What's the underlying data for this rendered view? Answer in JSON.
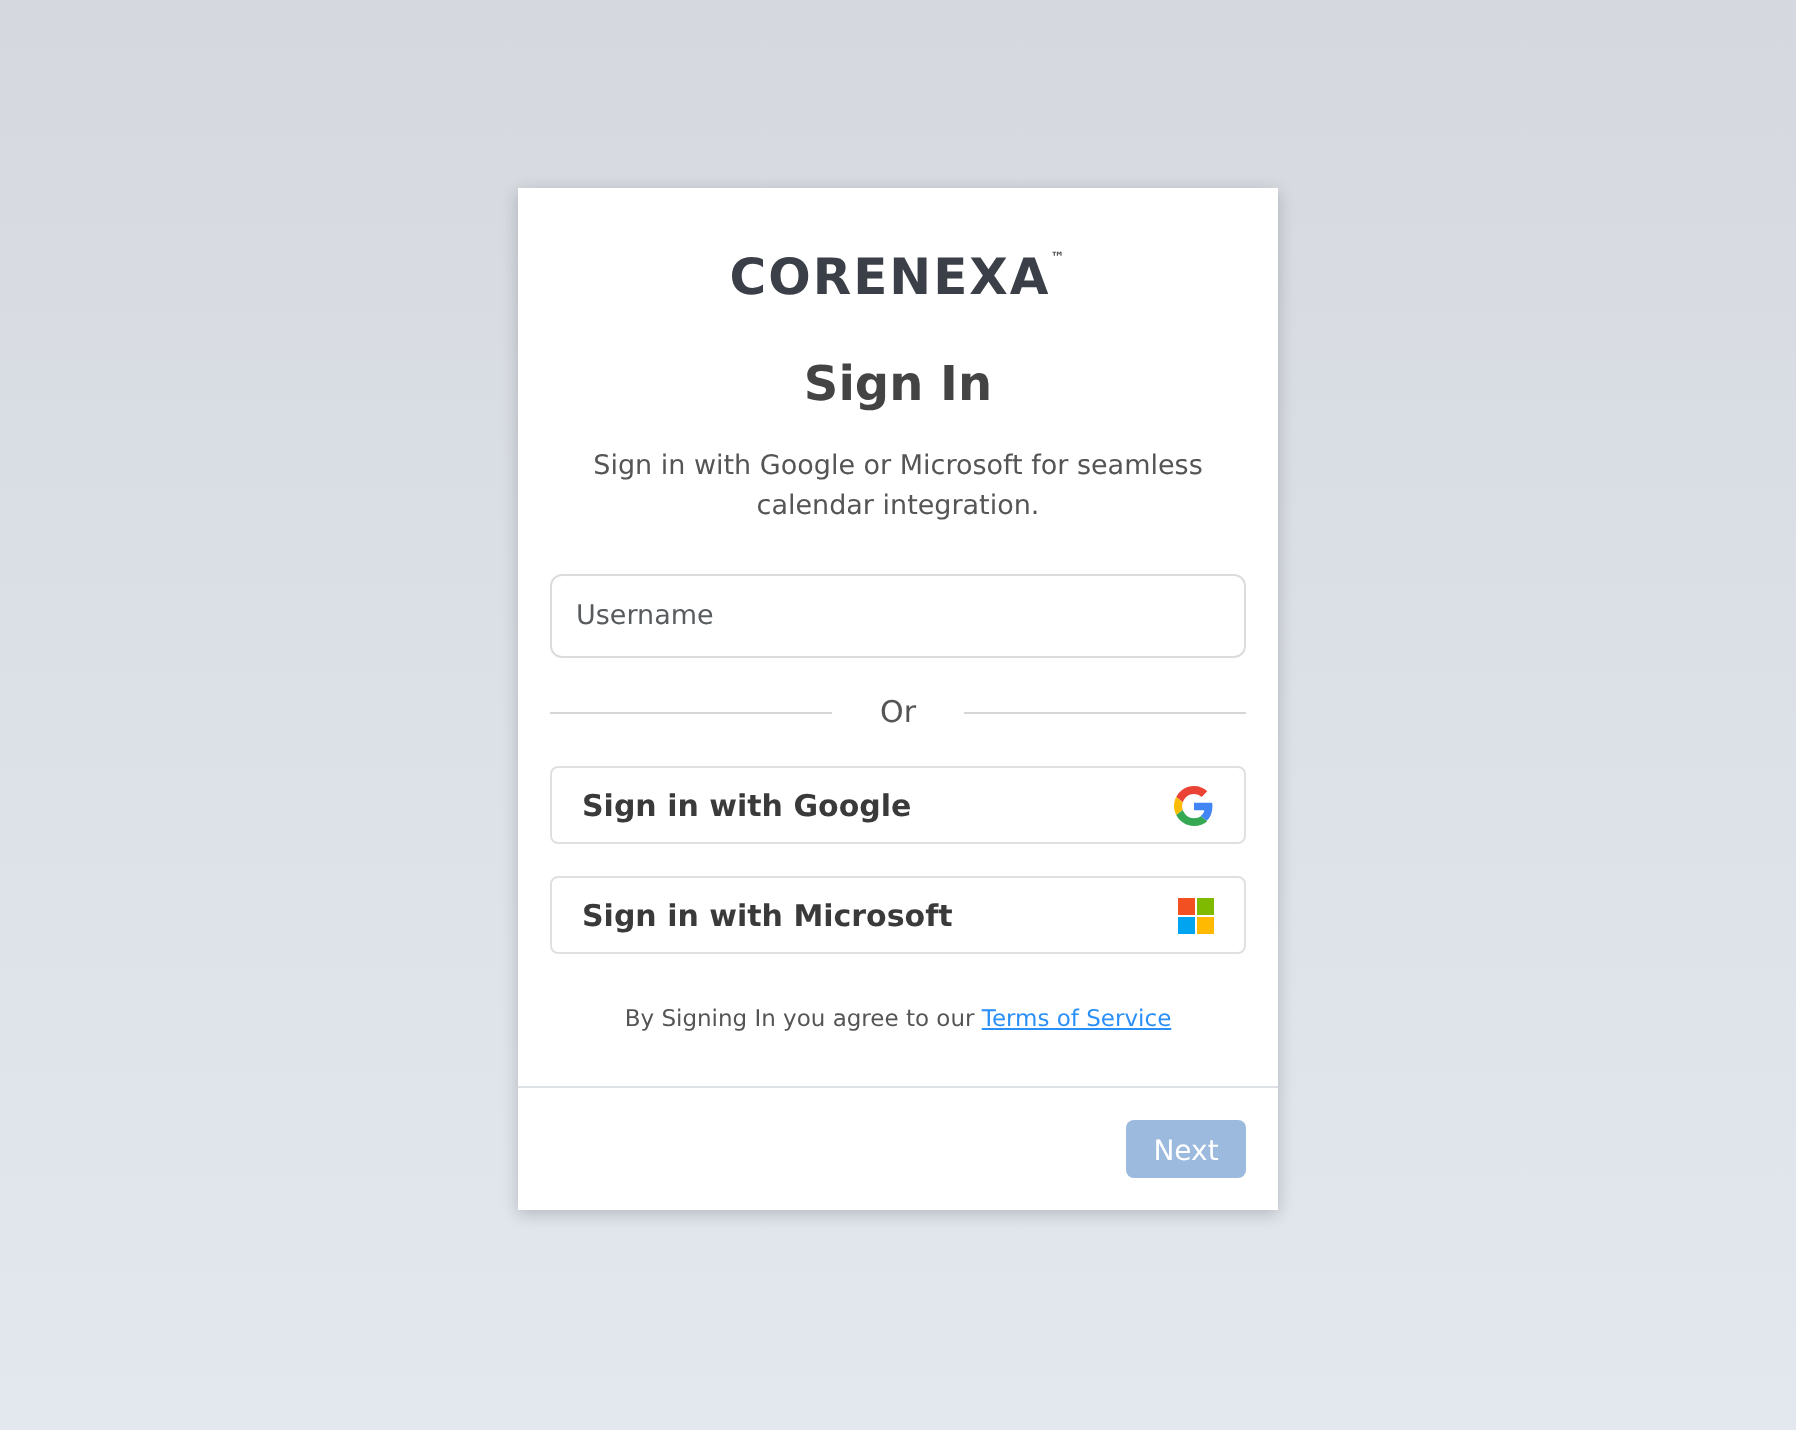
{
  "logo": {
    "name": "CORENEXA",
    "mark": "™"
  },
  "title": "Sign In",
  "subtitle": "Sign in with Google or Microsoft for seamless calendar integration.",
  "username": {
    "placeholder": "Username"
  },
  "divider": "Or",
  "providers": [
    {
      "kind": "google",
      "label": "Sign in with Google"
    },
    {
      "kind": "microsoft",
      "label": "Sign in with Microsoft"
    }
  ],
  "terms": {
    "text": "By Signing In you agree to our",
    "link": "Terms of Service"
  },
  "next": {
    "label": "Next",
    "disabled": true
  }
}
